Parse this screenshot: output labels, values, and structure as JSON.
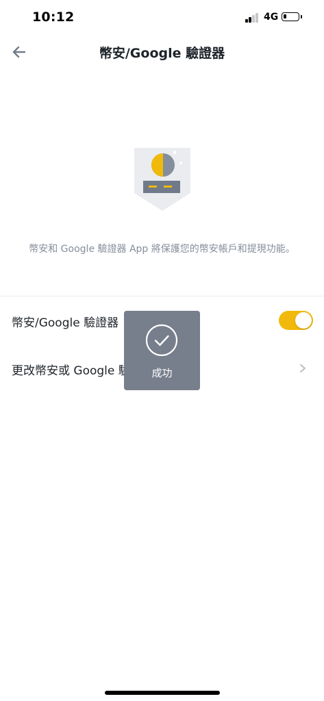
{
  "status_bar": {
    "time": "10:12",
    "network": "4G"
  },
  "header": {
    "title": "幣安/Google 驗證器"
  },
  "hero": {
    "icon": "authenticator-shield-icon",
    "description": "幣安和 Google 驗證器 App 將保護您的幣安帳戶和提現功能。"
  },
  "settings": {
    "items": [
      {
        "label": "幣安/Google 驗證器",
        "control": "toggle",
        "enabled": true
      },
      {
        "label": "更改幣安或 Google 驗",
        "control": "chevron-right-icon"
      }
    ]
  },
  "toast": {
    "icon": "check-circle-icon",
    "message": "成功"
  },
  "colors": {
    "accent": "#f0b90b",
    "text_primary": "#1e2329",
    "text_secondary": "#848e9c",
    "toast_bg": "#777e8c"
  }
}
